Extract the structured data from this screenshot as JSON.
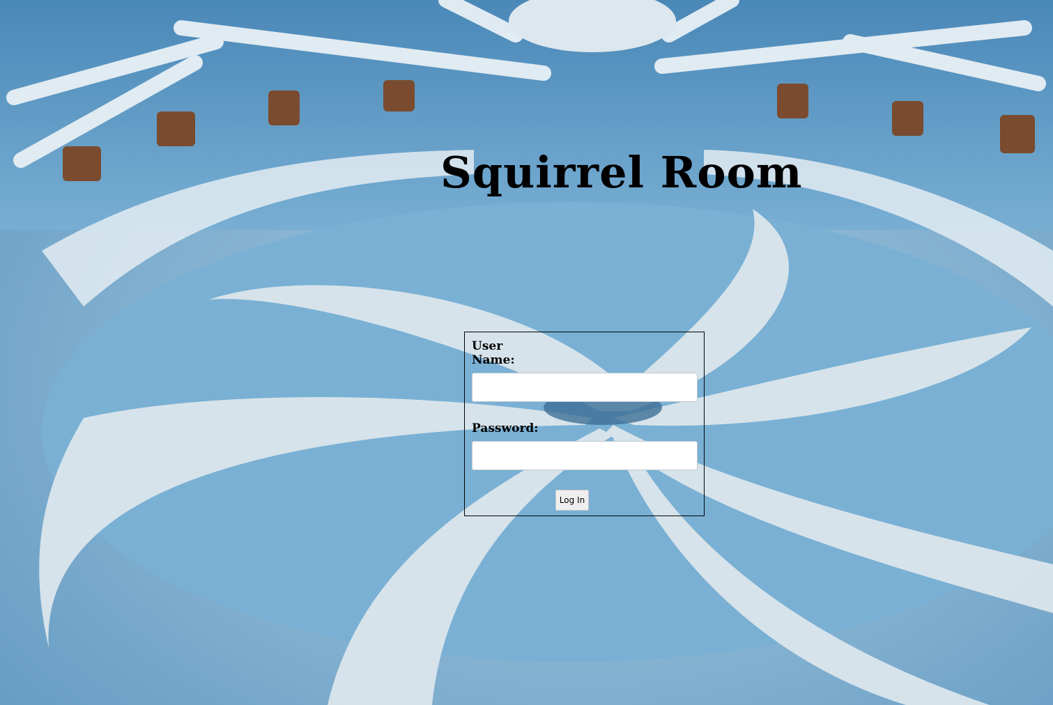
{
  "page": {
    "title": "Squirrel Room"
  },
  "login_form": {
    "username_label": "User Name:",
    "username_value": "",
    "password_label": "Password:",
    "password_value": "",
    "submit_label": "Log In"
  },
  "background": {
    "description_icon": "background-photo",
    "colors": {
      "floor_blue": "#6fa3c9",
      "floor_light": "#dfe9ee",
      "wall_blue": "#7fb1d3"
    }
  }
}
